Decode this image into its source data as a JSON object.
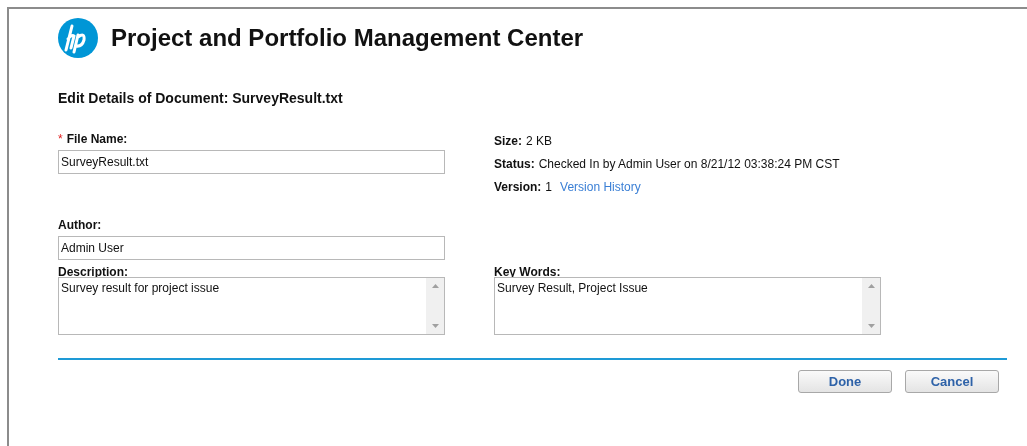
{
  "header": {
    "title": "Project and Portfolio Management Center"
  },
  "page_title": "Edit Details of Document: SurveyResult.txt",
  "left_fields": [
    {
      "required_mark": "*",
      "label": "File Name:",
      "value": "SurveyResult.txt"
    },
    {
      "label": "Author:",
      "value": "Admin User"
    }
  ],
  "info": [
    {
      "label": "Size:",
      "value": "2 KB"
    },
    {
      "label": "Status:",
      "value": "Checked In by Admin User on 8/21/12 03:38:24 PM CST"
    },
    {
      "label": "Version:",
      "value": "1",
      "link": "Version History"
    }
  ],
  "text_areas": [
    {
      "label": "Description:",
      "value": "Survey result for project issue"
    },
    {
      "label": "Key Words:",
      "value": "Survey Result, Project Issue"
    }
  ],
  "buttons": [
    "Done",
    "Cancel"
  ]
}
